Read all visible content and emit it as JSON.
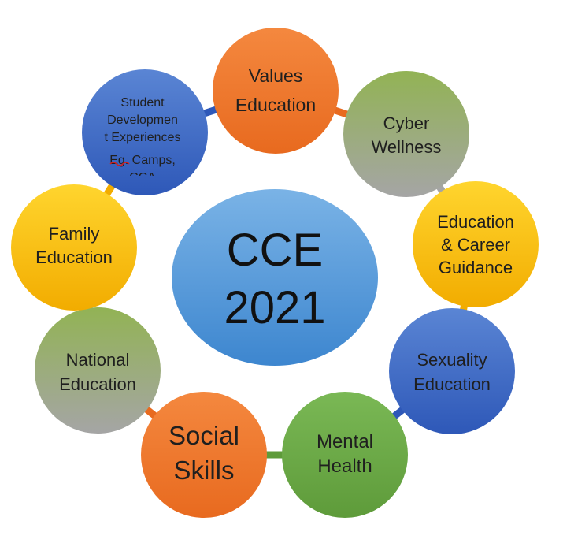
{
  "center": {
    "line1": "CCE",
    "line2": "2021",
    "color_top": "#7ab3e6",
    "color_bottom": "#3d86cf"
  },
  "nodes": [
    {
      "id": "values",
      "lines": [
        "Values",
        "Education"
      ],
      "colors": [
        "#f4883f",
        "#e86a1f"
      ]
    },
    {
      "id": "cyber",
      "lines": [
        "Cyber",
        "Wellness"
      ],
      "colors": [
        "#92b354",
        "#a5a5a5"
      ]
    },
    {
      "id": "ecg",
      "lines": [
        "Education",
        "& Career",
        "Guidance"
      ],
      "colors": [
        "#ffd52e",
        "#f2ac00"
      ]
    },
    {
      "id": "sexuality",
      "lines": [
        "Sexuality",
        "Education"
      ],
      "colors": [
        "#5a85d4",
        "#2e58b8"
      ]
    },
    {
      "id": "mental",
      "lines": [
        "Mental",
        "Health"
      ],
      "colors": [
        "#7ab855",
        "#5e9b3a"
      ]
    },
    {
      "id": "social",
      "lines": [
        "Social",
        "Skills"
      ],
      "colors": [
        "#f4883f",
        "#e86a1f"
      ]
    },
    {
      "id": "national",
      "lines": [
        "National",
        "Education"
      ],
      "colors": [
        "#92b354",
        "#a5a5a5"
      ]
    },
    {
      "id": "family",
      "lines": [
        "Family",
        "Education"
      ],
      "colors": [
        "#ffd52e",
        "#f2ac00"
      ]
    },
    {
      "id": "student",
      "lines": [
        "Student",
        "Developmen",
        "t Experiences",
        "Eg. Camps,",
        "CCA"
      ],
      "colors": [
        "#5a85d4",
        "#2e58b8"
      ]
    }
  ]
}
